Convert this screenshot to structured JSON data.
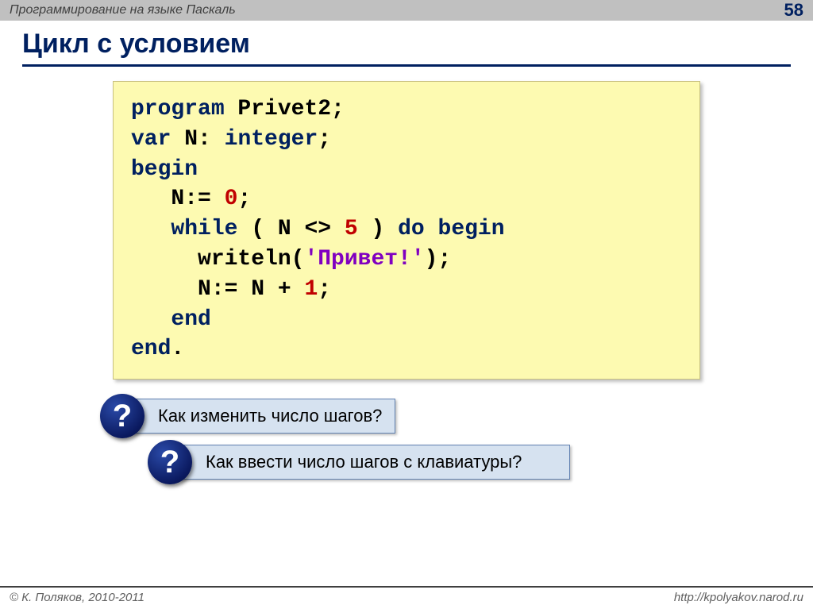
{
  "header": {
    "course_title": "Программирование на языке Паскаль",
    "page_number": "58"
  },
  "title": "Цикл с условием",
  "code": {
    "program_kw": "program",
    "program_name": " Privet2;",
    "var_kw": "var",
    "var_decl_name": " N: ",
    "integer_kw": "integer",
    "semicolon": ";",
    "begin_kw": "begin",
    "assign0_lhs": "   N:=",
    "assign0_sp": " ",
    "assign0_val": "0",
    "while_kw": "   while",
    "cond_open": " ( N",
    "cond_sp1": " ",
    "cond_op": "<>",
    "cond_sp2": " ",
    "cond_val": "5",
    "cond_close": " ) ",
    "do_begin_kw": "do begin",
    "writeln_call": "     writeln(",
    "writeln_str": "'Привет!'",
    "writeln_close": ");",
    "inc_lhs": "     N:=",
    "inc_sp1": " ",
    "inc_var": "N",
    "inc_sp2": " ",
    "inc_op": "+",
    "inc_sp3": " ",
    "inc_val": "1",
    "inc_end": ";",
    "inner_end_kw": "   end",
    "end_kw": "end",
    "dot": "."
  },
  "questions": [
    "Как изменить число шагов?",
    "Как ввести число шагов с клавиатуры?"
  ],
  "footer": {
    "copyright": "© К. Поляков, 2010-2011",
    "url": "http://kpolyakov.narod.ru"
  }
}
